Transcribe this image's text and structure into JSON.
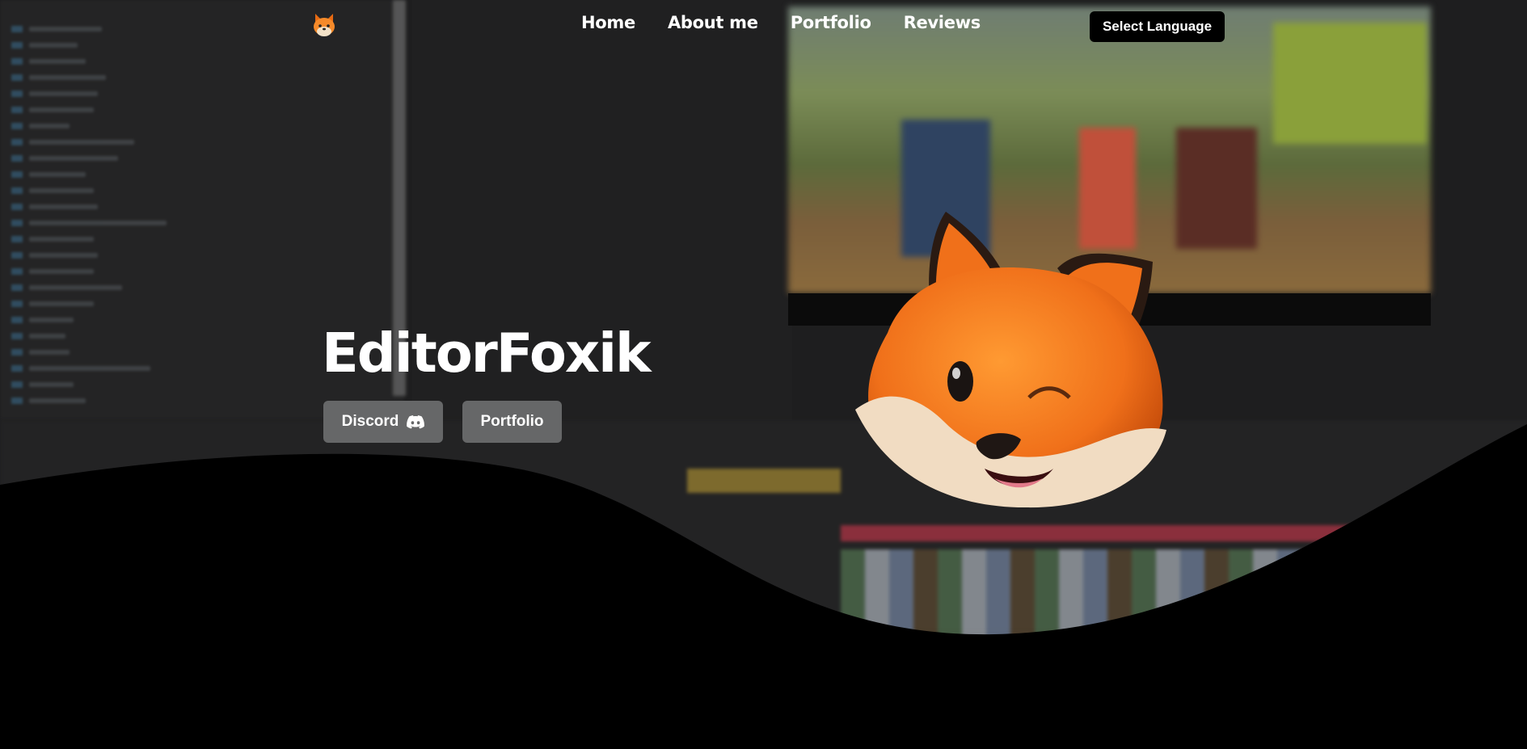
{
  "nav": {
    "logo_icon": "fox-icon",
    "items": [
      {
        "label": "Home"
      },
      {
        "label": "About me"
      },
      {
        "label": "Portfolio"
      },
      {
        "label": "Reviews"
      }
    ],
    "language_button": "Select Language"
  },
  "hero": {
    "title": "EditorFoxik",
    "buttons": {
      "discord": {
        "label": "Discord",
        "icon": "discord-icon"
      },
      "portfolio": {
        "label": "Portfolio"
      }
    },
    "background": "blurred-video-editor-screenshot",
    "mascot": "fox-emoji-mascot"
  },
  "colors": {
    "page_bg": "#000000",
    "button_bg": "#666768",
    "text": "#ffffff",
    "fox_orange": "#f07a1c"
  }
}
